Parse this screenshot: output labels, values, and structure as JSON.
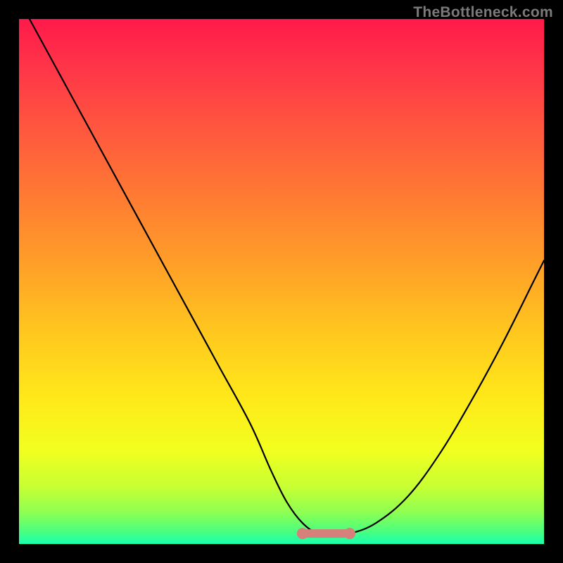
{
  "watermark": "TheBottleneck.com",
  "colors": {
    "black": "#000000",
    "flat_segment": "#d77f7a",
    "watermark_text": "#7a7a7a"
  },
  "gradient_stops": [
    {
      "offset": 0.0,
      "color": "#ff1a4b"
    },
    {
      "offset": 0.1,
      "color": "#ff3748"
    },
    {
      "offset": 0.22,
      "color": "#ff5a3d"
    },
    {
      "offset": 0.35,
      "color": "#ff7e32"
    },
    {
      "offset": 0.48,
      "color": "#ffa327"
    },
    {
      "offset": 0.6,
      "color": "#ffc81e"
    },
    {
      "offset": 0.72,
      "color": "#ffe81a"
    },
    {
      "offset": 0.82,
      "color": "#f2ff1e"
    },
    {
      "offset": 0.89,
      "color": "#c8ff32"
    },
    {
      "offset": 0.94,
      "color": "#8eff52"
    },
    {
      "offset": 0.975,
      "color": "#4cff7d"
    },
    {
      "offset": 1.0,
      "color": "#18ffb0"
    }
  ],
  "chart_data": {
    "type": "line",
    "title": "",
    "xlabel": "",
    "ylabel": "",
    "xlim": [
      0,
      100
    ],
    "ylim": [
      0,
      100
    ],
    "grid": false,
    "legend_position": "none",
    "annotations": [
      "TheBottleneck.com"
    ],
    "series": [
      {
        "name": "bottleneck-curve",
        "x": [
          2,
          8,
          14,
          20,
          26,
          32,
          38,
          44,
          48,
          51,
          54,
          57,
          60,
          63,
          68,
          74,
          80,
          86,
          92,
          98,
          100
        ],
        "values": [
          100,
          89,
          78,
          67,
          56,
          45,
          34,
          23,
          14,
          8,
          4,
          2,
          2,
          2,
          4,
          9,
          17,
          27,
          38,
          50,
          54
        ]
      },
      {
        "name": "optimal-range-flat",
        "x": [
          54,
          57,
          60,
          63
        ],
        "values": [
          2,
          2,
          2,
          2
        ]
      }
    ]
  }
}
